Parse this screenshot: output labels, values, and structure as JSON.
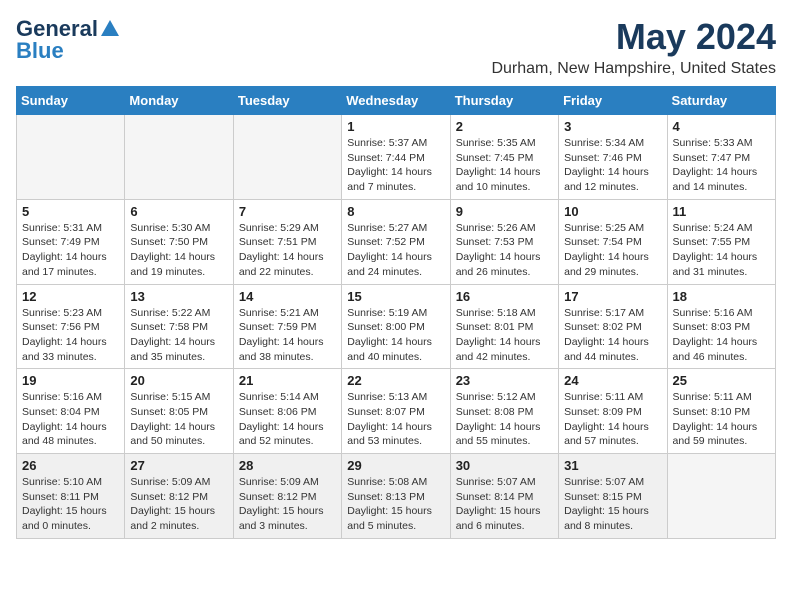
{
  "logo": {
    "general": "General",
    "blue": "Blue"
  },
  "title": {
    "month_year": "May 2024",
    "location": "Durham, New Hampshire, United States"
  },
  "days_of_week": [
    "Sunday",
    "Monday",
    "Tuesday",
    "Wednesday",
    "Thursday",
    "Friday",
    "Saturday"
  ],
  "weeks": [
    [
      {
        "day": "",
        "info": ""
      },
      {
        "day": "",
        "info": ""
      },
      {
        "day": "",
        "info": ""
      },
      {
        "day": "1",
        "info": "Sunrise: 5:37 AM\nSunset: 7:44 PM\nDaylight: 14 hours\nand 7 minutes."
      },
      {
        "day": "2",
        "info": "Sunrise: 5:35 AM\nSunset: 7:45 PM\nDaylight: 14 hours\nand 10 minutes."
      },
      {
        "day": "3",
        "info": "Sunrise: 5:34 AM\nSunset: 7:46 PM\nDaylight: 14 hours\nand 12 minutes."
      },
      {
        "day": "4",
        "info": "Sunrise: 5:33 AM\nSunset: 7:47 PM\nDaylight: 14 hours\nand 14 minutes."
      }
    ],
    [
      {
        "day": "5",
        "info": "Sunrise: 5:31 AM\nSunset: 7:49 PM\nDaylight: 14 hours\nand 17 minutes."
      },
      {
        "day": "6",
        "info": "Sunrise: 5:30 AM\nSunset: 7:50 PM\nDaylight: 14 hours\nand 19 minutes."
      },
      {
        "day": "7",
        "info": "Sunrise: 5:29 AM\nSunset: 7:51 PM\nDaylight: 14 hours\nand 22 minutes."
      },
      {
        "day": "8",
        "info": "Sunrise: 5:27 AM\nSunset: 7:52 PM\nDaylight: 14 hours\nand 24 minutes."
      },
      {
        "day": "9",
        "info": "Sunrise: 5:26 AM\nSunset: 7:53 PM\nDaylight: 14 hours\nand 26 minutes."
      },
      {
        "day": "10",
        "info": "Sunrise: 5:25 AM\nSunset: 7:54 PM\nDaylight: 14 hours\nand 29 minutes."
      },
      {
        "day": "11",
        "info": "Sunrise: 5:24 AM\nSunset: 7:55 PM\nDaylight: 14 hours\nand 31 minutes."
      }
    ],
    [
      {
        "day": "12",
        "info": "Sunrise: 5:23 AM\nSunset: 7:56 PM\nDaylight: 14 hours\nand 33 minutes."
      },
      {
        "day": "13",
        "info": "Sunrise: 5:22 AM\nSunset: 7:58 PM\nDaylight: 14 hours\nand 35 minutes."
      },
      {
        "day": "14",
        "info": "Sunrise: 5:21 AM\nSunset: 7:59 PM\nDaylight: 14 hours\nand 38 minutes."
      },
      {
        "day": "15",
        "info": "Sunrise: 5:19 AM\nSunset: 8:00 PM\nDaylight: 14 hours\nand 40 minutes."
      },
      {
        "day": "16",
        "info": "Sunrise: 5:18 AM\nSunset: 8:01 PM\nDaylight: 14 hours\nand 42 minutes."
      },
      {
        "day": "17",
        "info": "Sunrise: 5:17 AM\nSunset: 8:02 PM\nDaylight: 14 hours\nand 44 minutes."
      },
      {
        "day": "18",
        "info": "Sunrise: 5:16 AM\nSunset: 8:03 PM\nDaylight: 14 hours\nand 46 minutes."
      }
    ],
    [
      {
        "day": "19",
        "info": "Sunrise: 5:16 AM\nSunset: 8:04 PM\nDaylight: 14 hours\nand 48 minutes."
      },
      {
        "day": "20",
        "info": "Sunrise: 5:15 AM\nSunset: 8:05 PM\nDaylight: 14 hours\nand 50 minutes."
      },
      {
        "day": "21",
        "info": "Sunrise: 5:14 AM\nSunset: 8:06 PM\nDaylight: 14 hours\nand 52 minutes."
      },
      {
        "day": "22",
        "info": "Sunrise: 5:13 AM\nSunset: 8:07 PM\nDaylight: 14 hours\nand 53 minutes."
      },
      {
        "day": "23",
        "info": "Sunrise: 5:12 AM\nSunset: 8:08 PM\nDaylight: 14 hours\nand 55 minutes."
      },
      {
        "day": "24",
        "info": "Sunrise: 5:11 AM\nSunset: 8:09 PM\nDaylight: 14 hours\nand 57 minutes."
      },
      {
        "day": "25",
        "info": "Sunrise: 5:11 AM\nSunset: 8:10 PM\nDaylight: 14 hours\nand 59 minutes."
      }
    ],
    [
      {
        "day": "26",
        "info": "Sunrise: 5:10 AM\nSunset: 8:11 PM\nDaylight: 15 hours\nand 0 minutes."
      },
      {
        "day": "27",
        "info": "Sunrise: 5:09 AM\nSunset: 8:12 PM\nDaylight: 15 hours\nand 2 minutes."
      },
      {
        "day": "28",
        "info": "Sunrise: 5:09 AM\nSunset: 8:12 PM\nDaylight: 15 hours\nand 3 minutes."
      },
      {
        "day": "29",
        "info": "Sunrise: 5:08 AM\nSunset: 8:13 PM\nDaylight: 15 hours\nand 5 minutes."
      },
      {
        "day": "30",
        "info": "Sunrise: 5:07 AM\nSunset: 8:14 PM\nDaylight: 15 hours\nand 6 minutes."
      },
      {
        "day": "31",
        "info": "Sunrise: 5:07 AM\nSunset: 8:15 PM\nDaylight: 15 hours\nand 8 minutes."
      },
      {
        "day": "",
        "info": ""
      }
    ]
  ]
}
